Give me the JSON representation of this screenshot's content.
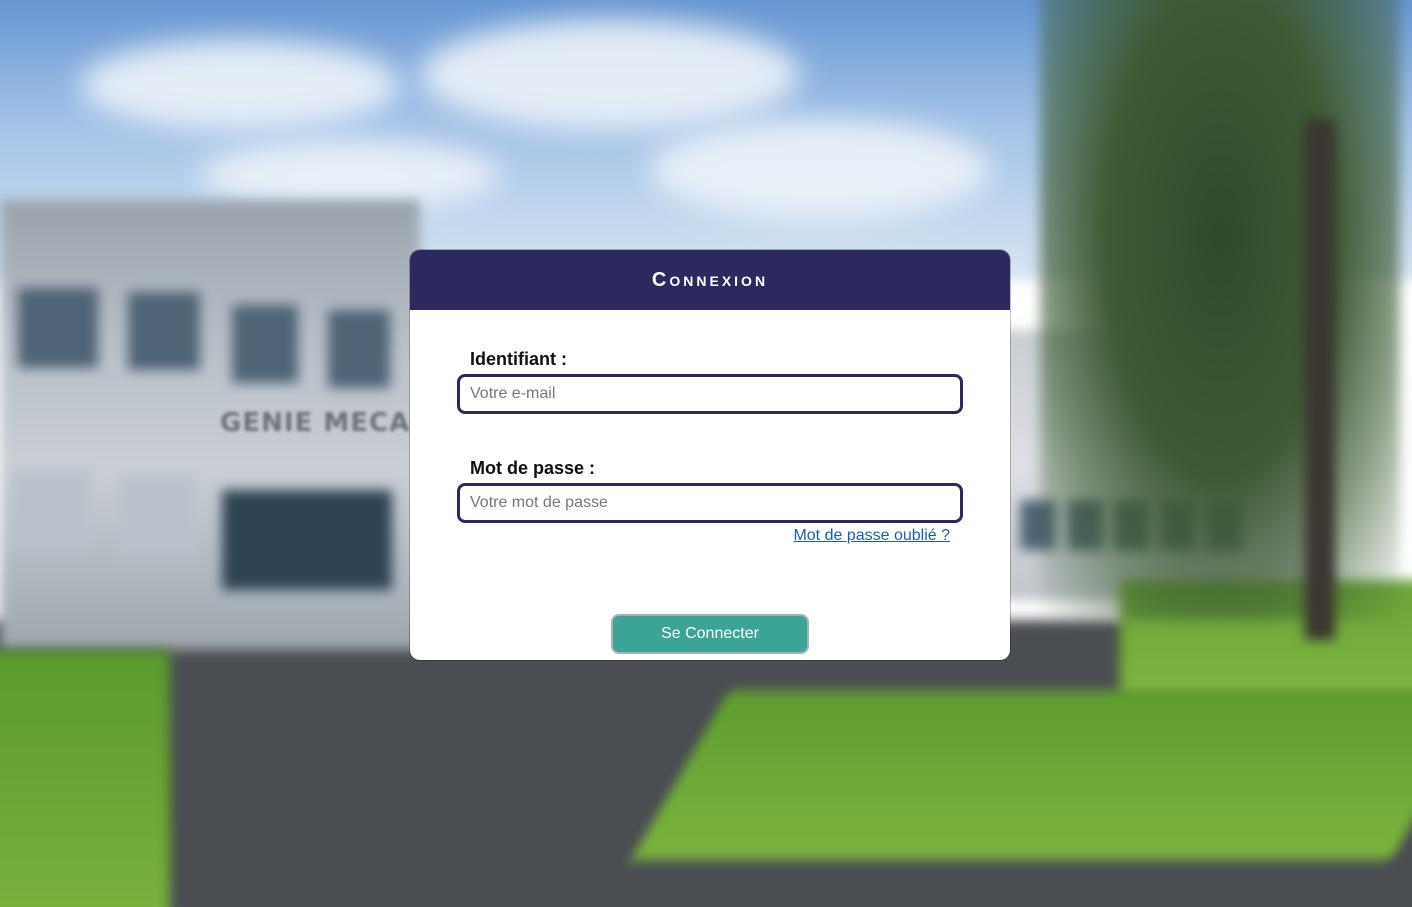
{
  "login": {
    "title": "Connexion",
    "identifier_label": "Identifiant :",
    "identifier_placeholder": "Votre e-mail",
    "identifier_value": "",
    "password_label": "Mot de passe :",
    "password_placeholder": "Votre mot de passe",
    "password_value": "",
    "forgot_link": "Mot de passe oublié ?",
    "submit_label": "Se Connecter"
  },
  "background": {
    "building_sign": "GENIE MECA"
  },
  "colors": {
    "header": "#2b295e",
    "input_border": "#2b295e",
    "submit": "#3aa497",
    "link": "#1a5fb4"
  }
}
